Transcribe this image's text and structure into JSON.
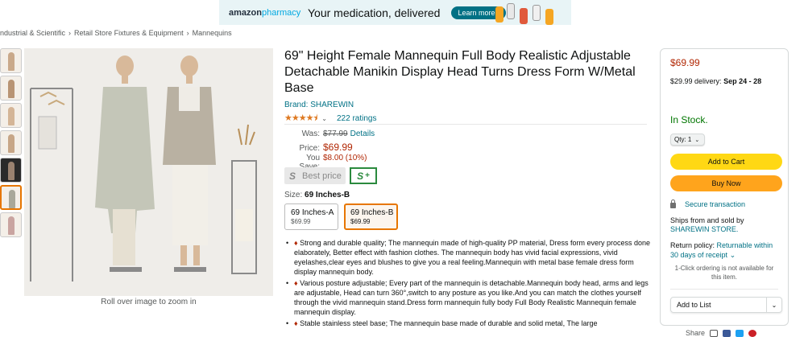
{
  "banner": {
    "brand_main": "amazon",
    "brand_sub": "pharmacy",
    "headline": "Your medication, delivered",
    "cta": "Learn more ›"
  },
  "breadcrumb": [
    "ndustrial & Scientific",
    "Retail Store Fixtures & Equipment",
    "Mannequins"
  ],
  "gallery": {
    "zoom_note": "Roll over image to zoom in"
  },
  "product": {
    "title": "69\" Height Female Mannequin Full Body Realistic Adjustable Detachable Manikin Display Head Turns Dress Form W/Metal Base",
    "brand": "Brand: SHAREWIN",
    "stars": "★★★★⯨",
    "ratings": "222 ratings",
    "price_table": {
      "was_label": "Was:",
      "was_value": "$77.99",
      "details": "Details",
      "price_label": "Price:",
      "price_value": "$69.99",
      "save_label": "You Save:",
      "save_value": "$8.00 (10%)"
    },
    "best_price": "Best price",
    "size_label": "Size:",
    "size_selected": "69 Inches-B",
    "sizes": [
      {
        "name": "69 Inches-A",
        "price": "$69.99"
      },
      {
        "name": "69 Inches-B",
        "price": "$69.99"
      }
    ],
    "bullets": [
      "Strong and durable quality; The mannequin made of high-quality PP material, Dress form every process done elaborately, Better effect with fashion clothes. The mannequin body has vivid facial expressions, vivid eyelashes,clear eyes and blushes to give you a real feeling.Mannequin with metal base female dress form display mannequin body.",
      "Various posture adjustable; Every part of the mannequin is detachable.Mannequin body head, arms and legs are adjustable, Head can turn 360°,switch to any posture as you like.And you can match the clothes yourself through the vivid mannequin stand.Dress form mannequin fully body Full Body Realistic Mannequin female mannequin display.",
      "Stable stainless steel base; The mannequin base made of durable and solid metal, The large"
    ]
  },
  "buybox": {
    "price": "$69.99",
    "delivery_prefix": "$29.99 delivery:",
    "delivery_dates": "Sep 24 - 28",
    "stock": "In Stock.",
    "qty": "Qty: 1",
    "add_to_cart": "Add to Cart",
    "buy_now": "Buy Now",
    "secure": "Secure transaction",
    "ships_from": "Ships from and sold by",
    "seller": "SHAREWIN STORE.",
    "return_label": "Return policy:",
    "return_link": "Returnable within 30 days of receipt",
    "one_click": "1-Click ordering is not available for this item.",
    "add_to_list": "Add to List"
  },
  "share": {
    "label": "Share"
  },
  "colors": {
    "link": "#007185",
    "price": "#b12704",
    "stock": "#007600",
    "cart": "#ffd814",
    "buy": "#ffa41c",
    "selected": "#e77600"
  }
}
